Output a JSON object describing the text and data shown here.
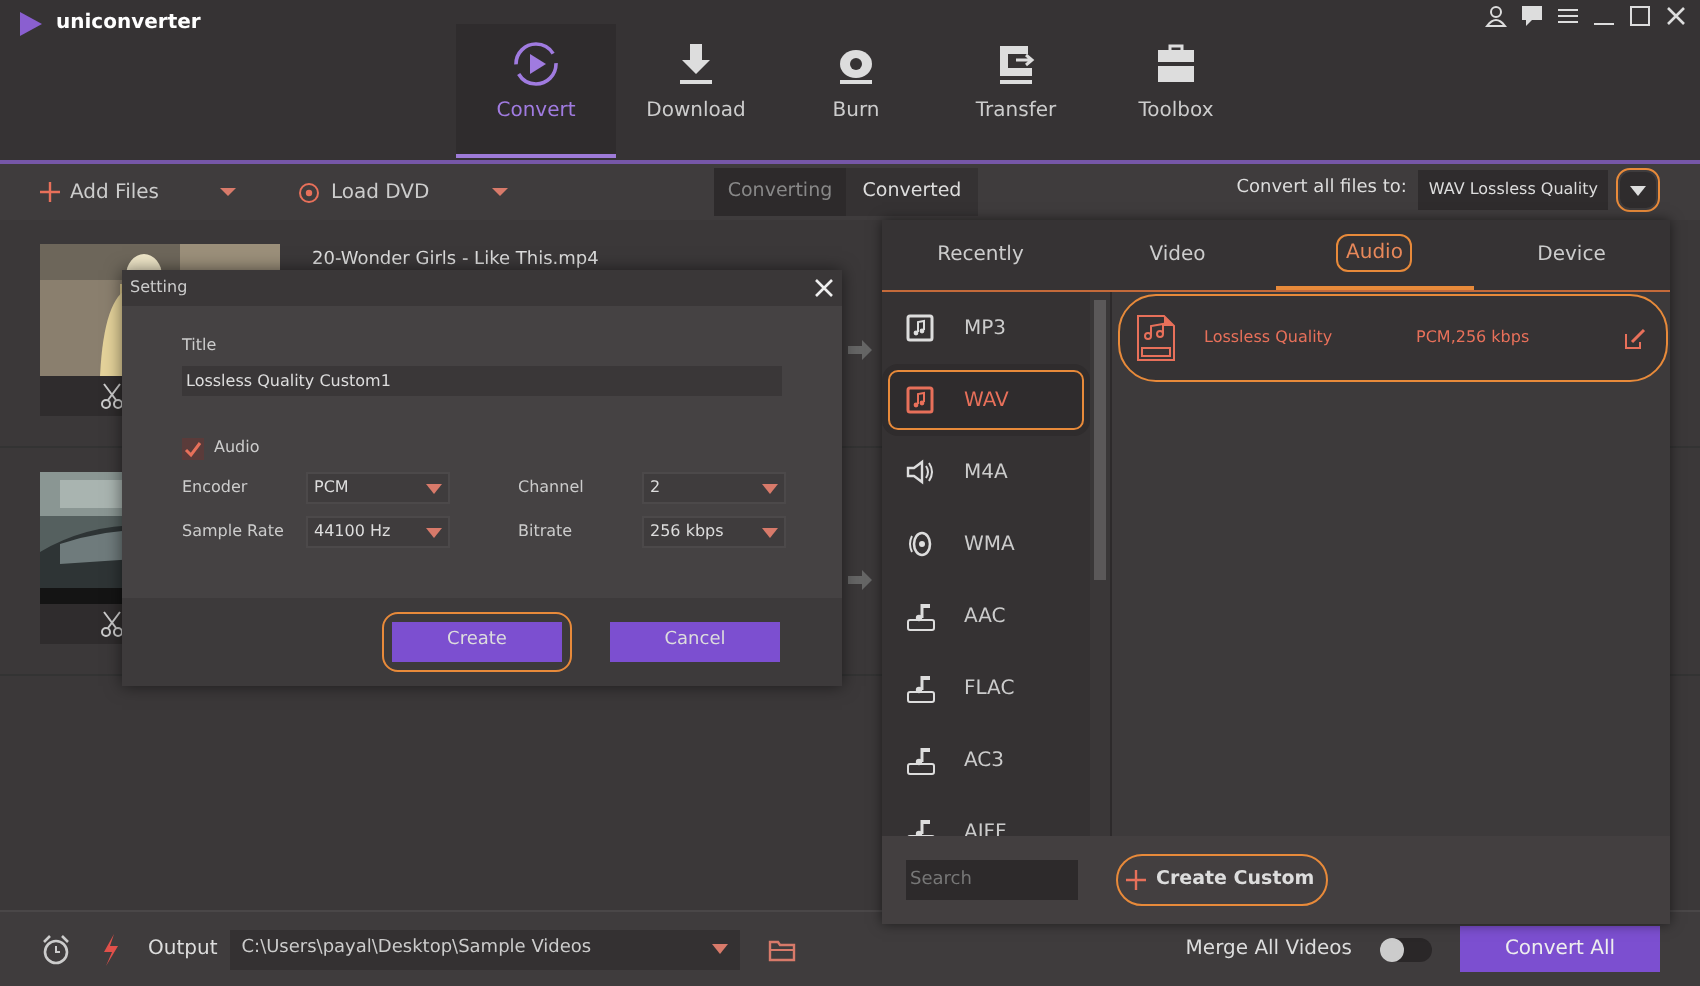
{
  "app": {
    "name": "uniconverter"
  },
  "nav_tabs": [
    {
      "label": "Convert",
      "selected": true,
      "kind": "convert"
    },
    {
      "label": "Download",
      "selected": false,
      "kind": "download"
    },
    {
      "label": "Burn",
      "selected": false,
      "kind": "burn"
    },
    {
      "label": "Transfer",
      "selected": false,
      "kind": "transfer"
    },
    {
      "label": "Toolbox",
      "selected": false,
      "kind": "toolbox"
    }
  ],
  "toolbar": {
    "add_files": "Add Files",
    "load_dvd": "Load DVD",
    "view_tabs": [
      {
        "label": "Converting",
        "selected": true
      },
      {
        "label": "Converted",
        "selected": false
      }
    ],
    "convert_all_label": "Convert all files to:",
    "convert_all_value": "WAV Lossless Quality",
    "dropdown_highlighted": true
  },
  "files": [
    {
      "name": "20-Wonder Girls - Like This.mp4",
      "kind": "person"
    },
    {
      "kind": "car"
    }
  ],
  "dialog": {
    "title": "Setting",
    "title_label": "Title",
    "title_value": "Lossless Quality Custom1",
    "audio": {
      "label": "Audio",
      "checked": true
    },
    "fields": [
      {
        "label": "Encoder",
        "value": "PCM"
      },
      {
        "label": "Channel",
        "value": "2"
      },
      {
        "label": "Sample Rate",
        "value": "44100 Hz"
      },
      {
        "label": "Bitrate",
        "value": "256 kbps"
      }
    ],
    "buttons": [
      {
        "label": "Create",
        "highlighted": true
      },
      {
        "label": "Cancel",
        "highlighted": false
      }
    ]
  },
  "format_panel": {
    "tabs": [
      {
        "label": "Recently",
        "selected": false,
        "highlighted": false
      },
      {
        "label": "Video",
        "selected": false,
        "highlighted": false
      },
      {
        "label": "Audio",
        "selected": true,
        "highlighted": true
      },
      {
        "label": "Device",
        "selected": false,
        "highlighted": false
      }
    ],
    "formats": [
      {
        "label": "MP3",
        "selected": false,
        "highlighted": false,
        "kind": "note"
      },
      {
        "label": "WAV",
        "selected": true,
        "highlighted": true,
        "kind": "note"
      },
      {
        "label": "M4A",
        "selected": false,
        "highlighted": false,
        "kind": "speaker"
      },
      {
        "label": "WMA",
        "selected": false,
        "highlighted": false,
        "kind": "disc"
      },
      {
        "label": "AAC",
        "selected": false,
        "highlighted": false,
        "kind": "flag"
      },
      {
        "label": "FLAC",
        "selected": false,
        "highlighted": false,
        "kind": "flag"
      },
      {
        "label": "AC3",
        "selected": false,
        "highlighted": false,
        "kind": "flag"
      },
      {
        "label": "AIFF",
        "selected": false,
        "highlighted": false,
        "kind": "flag"
      }
    ],
    "presets": [
      {
        "name": "Lossless Quality",
        "detail": "PCM,256 kbps",
        "highlighted": true
      }
    ],
    "search": {
      "placeholder": "Search"
    },
    "create_custom": {
      "label": "Create Custom",
      "highlighted": true
    }
  },
  "footer": {
    "output_label": "Output",
    "output_path": "C:\\Users\\payal\\Desktop\\Sample Videos",
    "merge_label": "Merge All Videos",
    "merge_on": false,
    "convert_all": "Convert All"
  }
}
